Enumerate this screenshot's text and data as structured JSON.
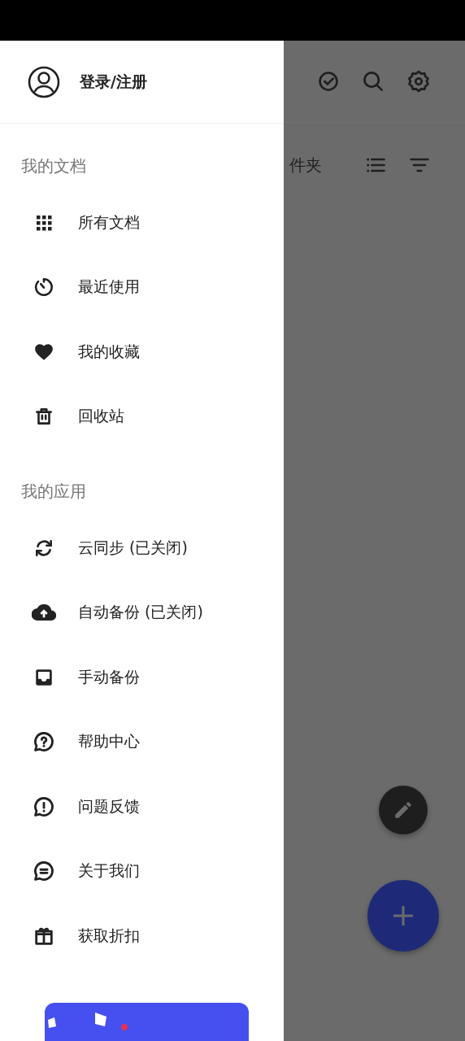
{
  "account": {
    "label": "登录/注册"
  },
  "sections": [
    {
      "title": "我的文档",
      "items": [
        {
          "label": "所有文档"
        },
        {
          "label": "最近使用"
        },
        {
          "label": "我的收藏"
        },
        {
          "label": "回收站"
        }
      ]
    },
    {
      "title": "我的应用",
      "items": [
        {
          "label": "云同步 (已关闭)"
        },
        {
          "label": "自动备份 (已关闭)"
        },
        {
          "label": "手动备份"
        },
        {
          "label": "帮助中心"
        },
        {
          "label": "问题反馈"
        },
        {
          "label": "关于我们"
        },
        {
          "label": "获取折扣"
        }
      ]
    }
  ],
  "background": {
    "folder_label": "件夹"
  }
}
